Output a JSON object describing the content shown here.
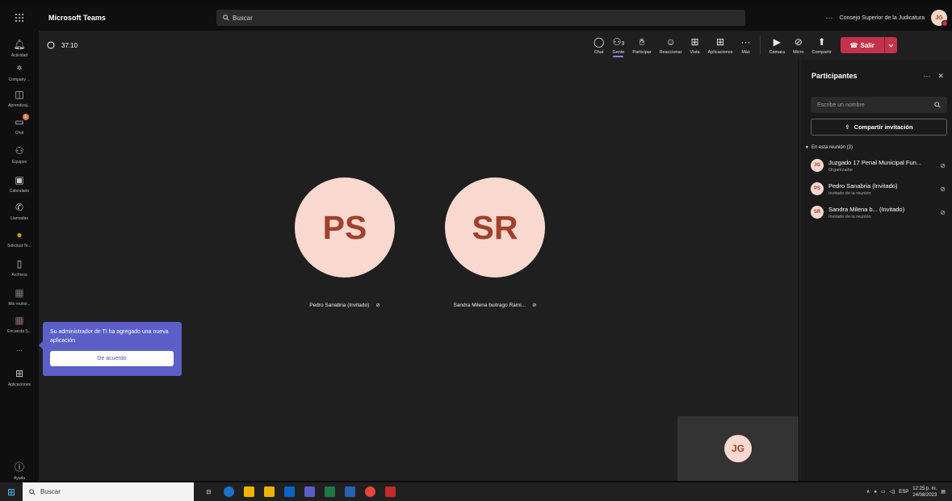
{
  "topbar": {
    "app_title": "Microsoft Teams",
    "search_placeholder": "Buscar",
    "more_label": "···",
    "org_name": "Consejo Superior de la Judicatura",
    "user_initials": "JG"
  },
  "rail": {
    "items": [
      {
        "label": "Actividad",
        "icon": "bell-icon"
      },
      {
        "label": "Company ...",
        "icon": "company-icon"
      },
      {
        "label": "Aprendizaj...",
        "icon": "learning-icon"
      },
      {
        "label": "Chat",
        "icon": "chat-icon",
        "badge": "1"
      },
      {
        "label": "Equipos",
        "icon": "teams-icon"
      },
      {
        "label": "Calendario",
        "icon": "calendar-icon"
      },
      {
        "label": "Llamadas",
        "icon": "phone-icon"
      },
      {
        "label": "Solicitud Te...",
        "icon": "request-icon"
      },
      {
        "label": "Archivos",
        "icon": "file-icon"
      },
      {
        "label": "Mis reunio...",
        "icon": "meetings-icon"
      },
      {
        "label": "Encuesta S...",
        "icon": "survey-icon"
      },
      {
        "label": "···",
        "icon": "more-icon"
      },
      {
        "label": "Aplicaciones",
        "icon": "apps-icon"
      },
      {
        "label": "Ayuda",
        "icon": "help-icon"
      }
    ]
  },
  "meeting": {
    "timer": "37:10",
    "controls": {
      "chat": "Chat",
      "people": "Gente",
      "people_count": "3",
      "raise": "Participar",
      "react": "Reaccionar",
      "view": "Vista",
      "apps": "Aplicaciones",
      "more": "Más",
      "camera": "Cámara",
      "mic": "Micro",
      "share": "Compartir",
      "leave": "Salir"
    },
    "tiles": [
      {
        "initials": "PS",
        "name": "Pedro Sanabria (Invitado)"
      },
      {
        "initials": "SR",
        "name": "Sandra Milena buitrago Rami..."
      }
    ],
    "self_initials": "JG"
  },
  "toast": {
    "text": "Su administrador de TI ha agregado una nueva aplicación",
    "button": "De acuerdo"
  },
  "panel": {
    "title": "Participantes",
    "search_placeholder": "Escribe un nombre",
    "share_button": "Compartir invitación",
    "section_label": "En esta reunión (3)",
    "people": [
      {
        "initials": "JG",
        "name": "Juzgado 17 Penal Municipal Fun...",
        "role": "Organizador"
      },
      {
        "initials": "PS",
        "name": "Pedro Sanabria (Invitado)",
        "role": "Invitado de la reunión"
      },
      {
        "initials": "SR",
        "name": "Sandra Milena b... (Invitado)",
        "role": "Invitado de la reunión"
      }
    ]
  },
  "taskbar": {
    "search_label": "Buscar",
    "language": "ESP",
    "time": "12:25 p. m.",
    "date": "14/08/2023"
  }
}
